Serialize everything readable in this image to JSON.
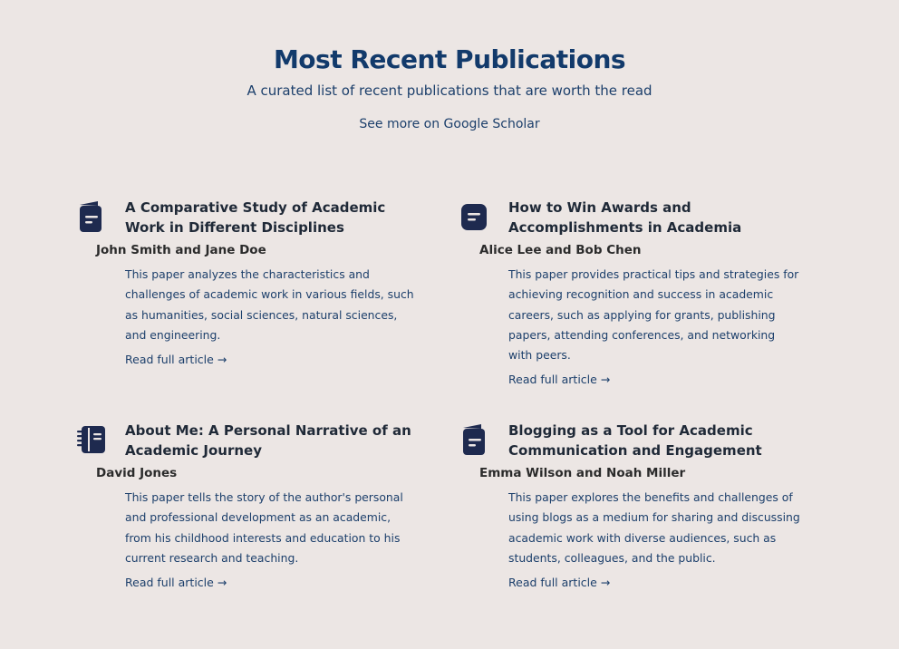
{
  "header": {
    "title": "Most Recent Publications",
    "subtitle": "A curated list of recent publications that are worth the read",
    "scholar_link": "See more on Google Scholar"
  },
  "colors": {
    "background": "#ece6e4",
    "accent": "#123a6b",
    "icon": "#1e2a4f"
  },
  "publications": [
    {
      "icon": "notebook-icon",
      "title": "A Comparative Study of Academic Work in Different Disciplines",
      "authors": "John Smith and Jane Doe",
      "description": "This paper analyzes the characteristics and challenges of academic work in various fields, such as humanities, social sciences, natural sciences, and engineering.",
      "link": "Read full article →"
    },
    {
      "icon": "message-square-icon",
      "title": "How to Win Awards and Accomplishments in Academia",
      "authors": "Alice Lee and Bob Chen",
      "description": "This paper provides practical tips and strategies for achieving recognition and success in academic careers, such as applying for grants, publishing papers, attending conferences, and networking with peers.",
      "link": "Read full article →"
    },
    {
      "icon": "spiral-notebook-icon",
      "title": "About Me: A Personal Narrative of an Academic Journey",
      "authors": "David Jones",
      "description": "This paper tells the story of the author's personal and professional development as an academic, from his childhood interests and education to his current research and teaching.",
      "link": "Read full article →"
    },
    {
      "icon": "notebook-icon",
      "title": "Blogging as a Tool for Academic Communication and Engagement",
      "authors": "Emma Wilson and Noah Miller",
      "description": "This paper explores the benefits and challenges of using blogs as a medium for sharing and discussing academic work with diverse audiences, such as students, colleagues, and the public.",
      "link": "Read full article →"
    }
  ]
}
